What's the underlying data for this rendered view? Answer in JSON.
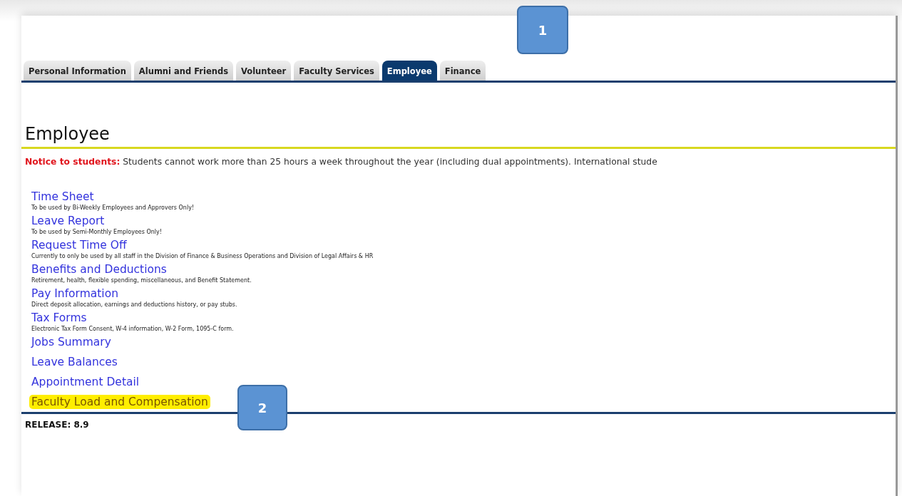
{
  "tabs": [
    {
      "label": "Personal Information",
      "selected": false
    },
    {
      "label": "Alumni and Friends",
      "selected": false
    },
    {
      "label": "Volunteer",
      "selected": false
    },
    {
      "label": "Faculty Services",
      "selected": false
    },
    {
      "label": "Employee",
      "selected": true
    },
    {
      "label": "Finance",
      "selected": false
    }
  ],
  "heading": "Employee",
  "notice": "**Notice to students:** Students cannot work more than 25 hours a week throughout the year (including dual appointments). International stude",
  "links": [
    {
      "label": "Time Sheet",
      "description": "To be used by Bi-Weekly Employees and Approvers Only!",
      "highlighted": false
    },
    {
      "label": "Leave Report",
      "description": "To be used by Semi-Monthly Employees Only!",
      "highlighted": false
    },
    {
      "label": "Request Time Off",
      "description": "Currently to only be used by all staff in the Division of Finance & Business Operations and Division of Legal Affairs & HR",
      "highlighted": false
    },
    {
      "label": "Benefits and Deductions",
      "description": "Retirement, health, flexible spending, miscellaneous, and Benefit Statement.",
      "highlighted": false
    },
    {
      "label": "Pay Information",
      "description": "Direct deposit allocation, earnings and deductions history, or pay stubs.",
      "highlighted": false
    },
    {
      "label": "Tax Forms",
      "description": "Electronic Tax Form Consent, W-4 information, W-2 Form, 1095-C form.",
      "highlighted": false
    },
    {
      "label": "Jobs Summary",
      "highlighted": false
    },
    {
      "label": "Leave Balances",
      "highlighted": false
    },
    {
      "label": "Appointment Detail",
      "highlighted": false
    },
    {
      "label": "Faculty Load and Compensation",
      "highlighted": true
    }
  ],
  "release": "RELEASE: 8.9",
  "callouts": [
    "1",
    "2"
  ]
}
